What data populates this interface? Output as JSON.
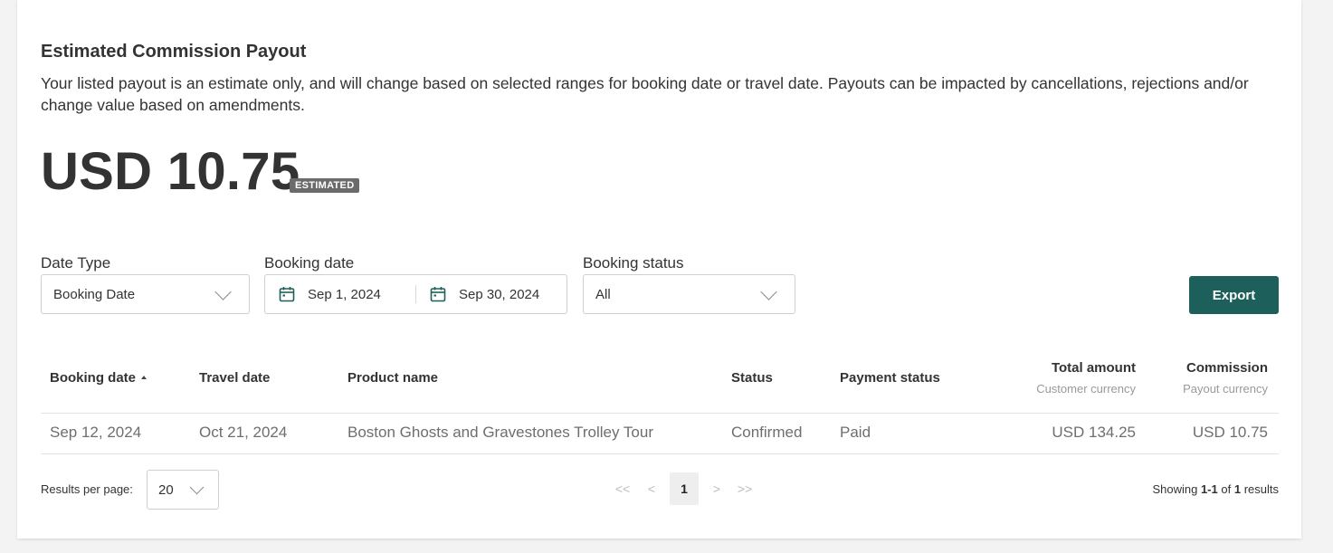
{
  "payout": {
    "heading": "Estimated Commission Payout",
    "description": "Your listed payout is an estimate only, and will change based on selected ranges for booking date or travel date. Payouts can be impacted by cancellations, rejections and/or change value based on amendments.",
    "amount": "USD 10.75",
    "badge": "ESTIMATED"
  },
  "filters": {
    "date_type": {
      "label": "Date Type",
      "value": "Booking Date"
    },
    "booking_date": {
      "label": "Booking date",
      "start": "Sep 1, 2024",
      "end": "Sep 30, 2024"
    },
    "booking_status": {
      "label": "Booking status",
      "value": "All"
    },
    "export_label": "Export"
  },
  "table": {
    "headers": {
      "booking_date": "Booking date",
      "travel_date": "Travel date",
      "product_name": "Product name",
      "status": "Status",
      "payment_status": "Payment status",
      "total_amount": "Total amount",
      "total_amount_sub": "Customer currency",
      "commission": "Commission",
      "commission_sub": "Payout currency"
    },
    "rows": [
      {
        "booking_date": "Sep 12, 2024",
        "travel_date": "Oct 21, 2024",
        "product_name": "Boston Ghosts and Gravestones Trolley Tour",
        "status": "Confirmed",
        "payment_status": "Paid",
        "total_amount": "USD 134.25",
        "commission": "USD 10.75"
      }
    ]
  },
  "pagination": {
    "rpp_label": "Results per page:",
    "rpp_value": "20",
    "first": "<<",
    "prev": "<",
    "current_page": "1",
    "next": ">",
    "last": ">>",
    "showing_prefix": "Showing",
    "showing_range": "1-1",
    "showing_of": "of",
    "showing_total": "1",
    "showing_suffix": "results"
  },
  "colors": {
    "accent": "#1d5f5a",
    "badge": "#6b6b6b"
  },
  "icons": {
    "calendar": "calendar-icon",
    "dropdown": "chevron-down-icon",
    "sort": "sort-ascending-icon"
  }
}
